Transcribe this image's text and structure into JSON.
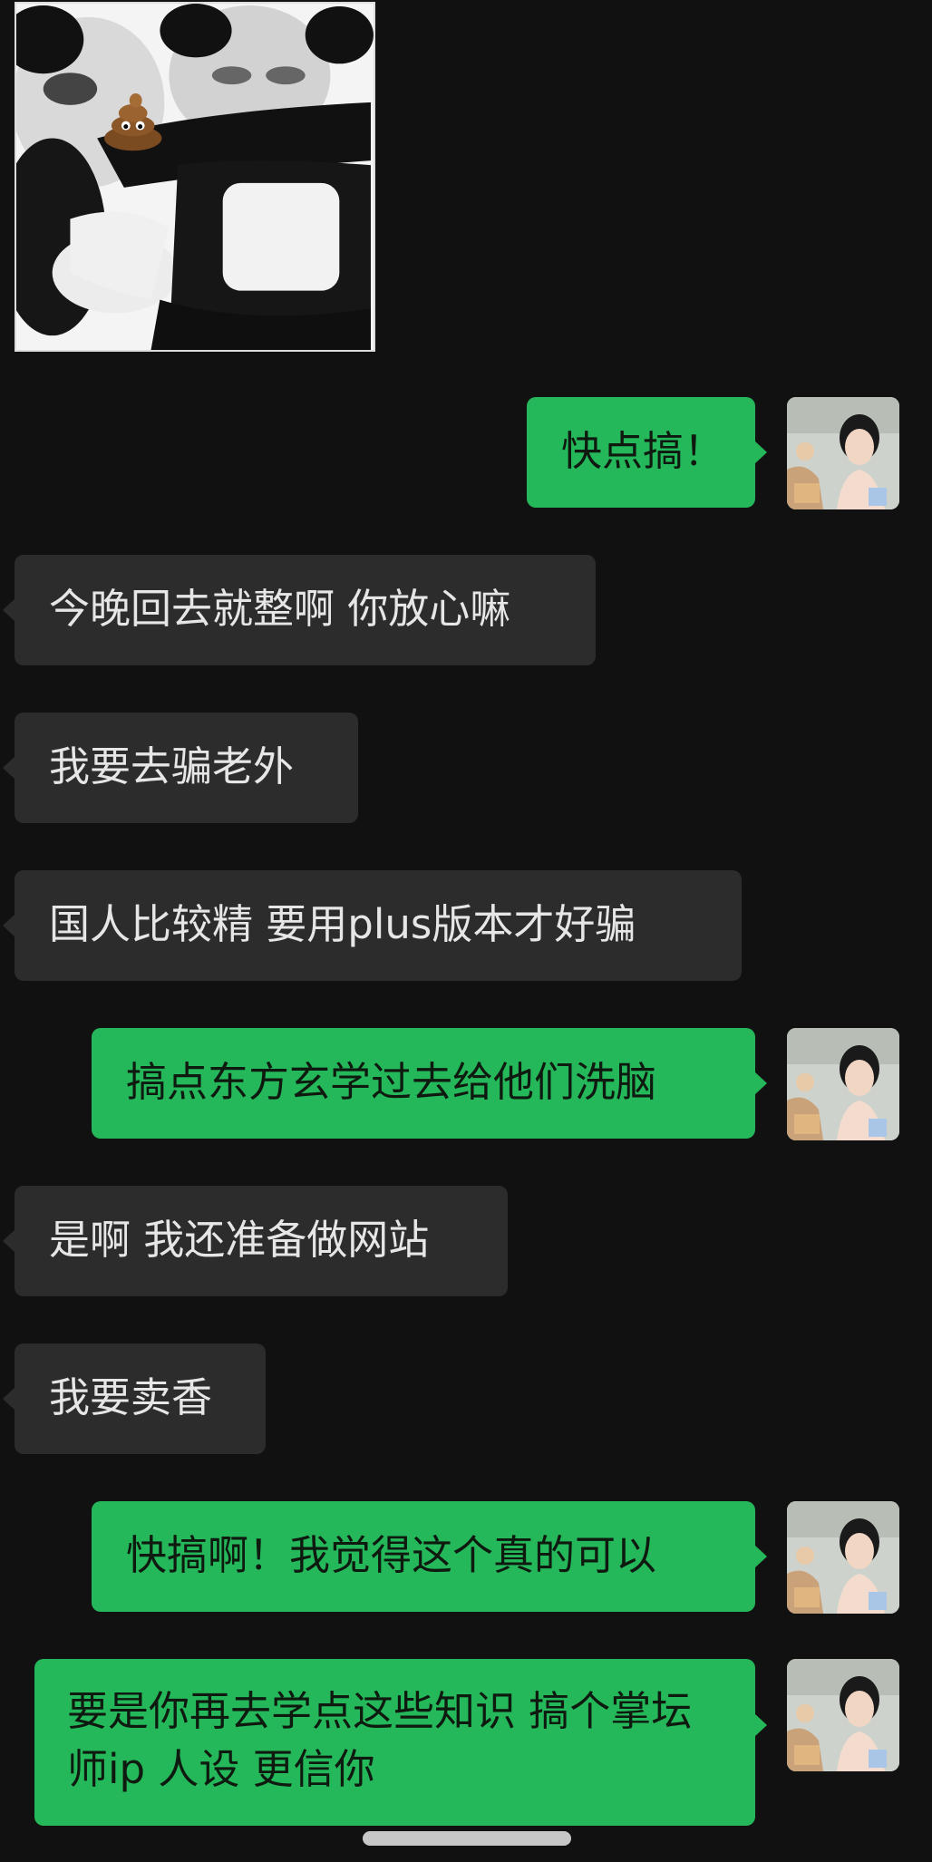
{
  "colors": {
    "background": "#111111",
    "incoming_bubble": "#2c2c2c",
    "outgoing_bubble": "#25b85a",
    "incoming_text": "#e6e6e6",
    "outgoing_text": "#0e1a10"
  },
  "sticker": {
    "icon": "panda-meme-sticker",
    "emoji": "💩"
  },
  "messages": [
    {
      "direction": "out",
      "text": "快点搞！"
    },
    {
      "direction": "in",
      "text": "今晚回去就整啊 你放心嘛"
    },
    {
      "direction": "in",
      "text": "我要去骗老外"
    },
    {
      "direction": "in",
      "text": "国人比较精 要用plus版本才好骗"
    },
    {
      "direction": "out",
      "text": "搞点东方玄学过去给他们洗脑"
    },
    {
      "direction": "in",
      "text": "是啊 我还准备做网站"
    },
    {
      "direction": "in",
      "text": "我要卖香"
    },
    {
      "direction": "out",
      "text": "快搞啊！我觉得这个真的可以"
    },
    {
      "direction": "out",
      "text": "要是你再去学点这些知识 搞个掌坛师ip 人设 更信你"
    }
  ]
}
